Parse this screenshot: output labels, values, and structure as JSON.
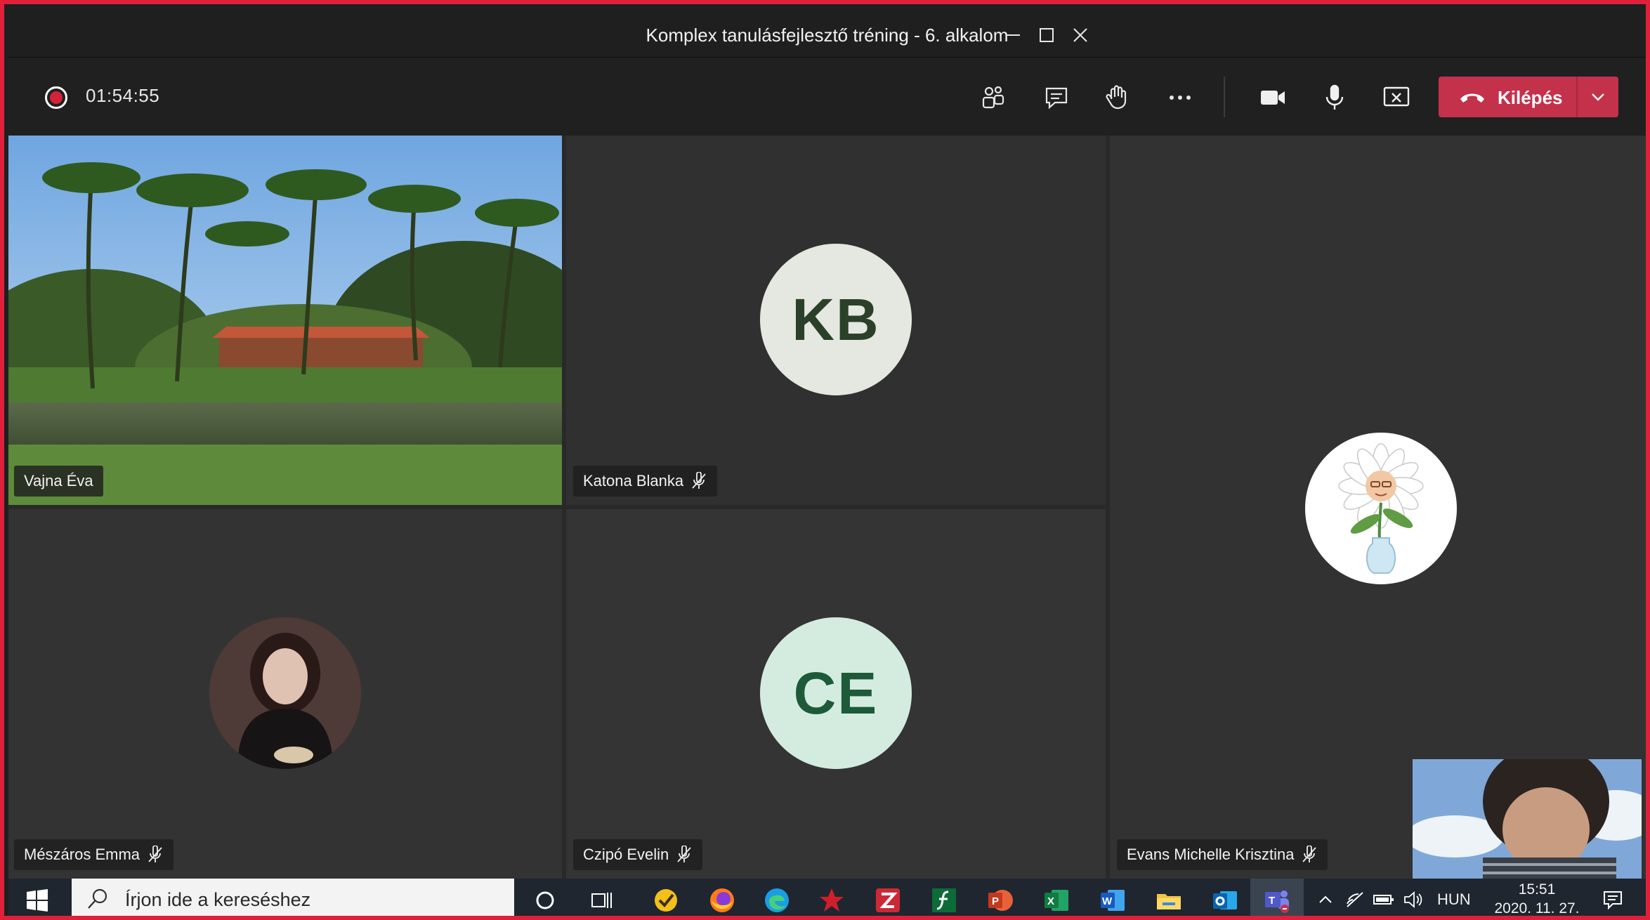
{
  "window": {
    "title": "Komplex tanulásfejlesztő tréning - 6. alkalom",
    "controls": [
      "minimize-icon",
      "maximize-icon",
      "close-icon"
    ]
  },
  "toolbar": {
    "recording_indicator": "recording-dot-icon",
    "timer": "01:54:55",
    "buttons": [
      "participants-icon",
      "chat-icon",
      "raise-hand-icon",
      "more-options-icon",
      "camera-icon",
      "microphone-icon",
      "share-screen-icon"
    ],
    "leave_label": "Kilépés",
    "leave_color": "#c4314b"
  },
  "participants": [
    {
      "name": "Vajna Éva",
      "muted": false,
      "video": "landscape-photo"
    },
    {
      "name": "Katona Blanka",
      "muted": true,
      "initials": "KB",
      "avatar_bg": "#e4e8e0",
      "avatar_fg": "#2b4028"
    },
    {
      "name": "Evans Michelle Krisztina",
      "muted": true,
      "avatar": "daisy-emoji-avatar"
    },
    {
      "name": "Mészáros Emma",
      "muted": true,
      "avatar": "profile-photo"
    },
    {
      "name": "Czipó Evelin",
      "muted": true,
      "initials": "CE",
      "avatar_bg": "#d4ecdf",
      "avatar_fg": "#1d5a3a"
    }
  ],
  "self_view": "self-camera-preview",
  "taskbar": {
    "search_placeholder": "Írjon ide a kereséshez",
    "pinned_apps": [
      "start-icon",
      "cortana-icon",
      "task-view-icon",
      "todo-icon",
      "firefox-icon",
      "edge-icon",
      "app-red-icon",
      "zotero-icon",
      "flash-icon",
      "powerpoint-icon",
      "excel-icon",
      "word-icon",
      "file-explorer-icon",
      "outlook-icon",
      "teams-icon"
    ],
    "language": "HUN",
    "time": "15:51",
    "date": "2020. 11. 27."
  }
}
